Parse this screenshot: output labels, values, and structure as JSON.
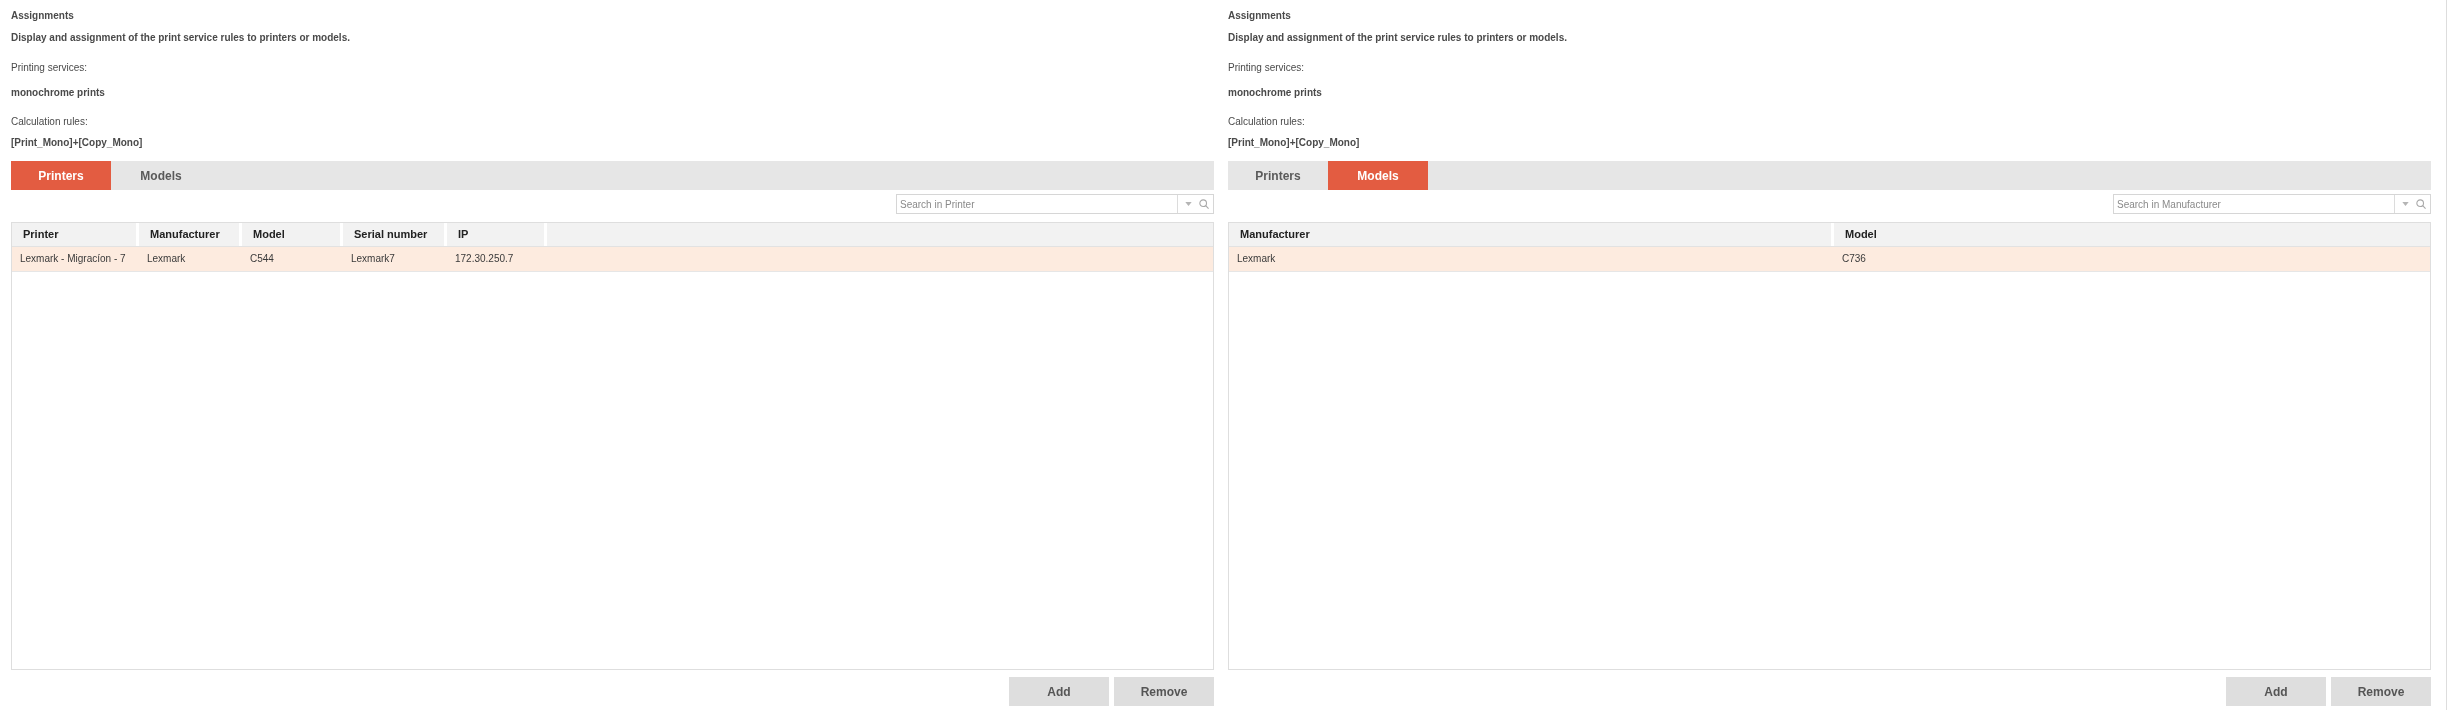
{
  "panels": [
    {
      "header": {
        "title": "Assignments",
        "description": "Display and assignment of the print service rules to printers or models."
      },
      "fields": [
        {
          "label": "Printing services:",
          "value": "monochrome prints"
        },
        {
          "label": "Calculation rules:",
          "value": "[Print_Mono]+[Copy_Mono]"
        }
      ],
      "tabs": [
        {
          "label": "Printers",
          "selected": true
        },
        {
          "label": "Models",
          "selected": false
        }
      ],
      "search": {
        "placeholder": "Search in Printer"
      },
      "table": {
        "columns": [
          "Printer",
          "Manufacturer",
          "Model",
          "Serial number",
          "IP"
        ],
        "rows": [
          {
            "cells": [
              "Lexmark - Migracíon - 7",
              "Lexmark",
              "C544",
              "Lexmark7",
              "172.30.250.7"
            ],
            "selected": true
          }
        ]
      },
      "buttons": [
        "Add",
        "Remove"
      ]
    },
    {
      "header": {
        "title": "Assignments",
        "description": "Display and assignment of the print service rules to printers or models."
      },
      "fields": [
        {
          "label": "Printing services:",
          "value": "monochrome prints"
        },
        {
          "label": "Calculation rules:",
          "value": "[Print_Mono]+[Copy_Mono]"
        }
      ],
      "tabs": [
        {
          "label": "Printers",
          "selected": false
        },
        {
          "label": "Models",
          "selected": true
        }
      ],
      "search": {
        "placeholder": "Search in Manufacturer"
      },
      "table": {
        "columns": [
          "Manufacturer",
          "Model"
        ],
        "rows": [
          {
            "cells": [
              "Lexmark",
              "C736"
            ],
            "selected": true
          }
        ]
      },
      "buttons": [
        "Add",
        "Remove"
      ]
    }
  ]
}
